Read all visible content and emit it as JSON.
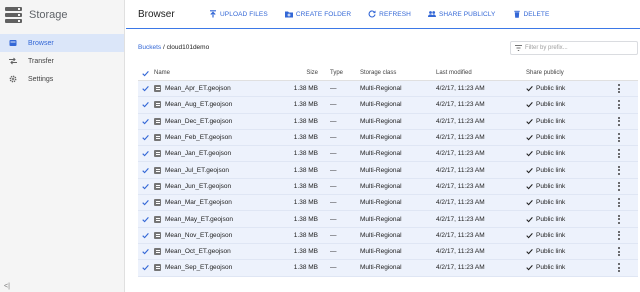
{
  "app": {
    "title": "Storage"
  },
  "sidebar": {
    "items": [
      {
        "label": "Browser",
        "icon": "bucket-icon",
        "active": true
      },
      {
        "label": "Transfer",
        "icon": "transfer-arrows-icon",
        "active": false
      },
      {
        "label": "Settings",
        "icon": "gear-icon",
        "active": false
      }
    ]
  },
  "toolbar": {
    "title": "Browser",
    "upload_label": "UPLOAD FILES",
    "create_folder_label": "CREATE FOLDER",
    "refresh_label": "REFRESH",
    "share_label": "SHARE PUBLICLY",
    "delete_label": "DELETE"
  },
  "breadcrumb": {
    "root": "Buckets",
    "separator": "/",
    "bucket": "cloud101demo"
  },
  "filter": {
    "placeholder": "Filter by prefix..."
  },
  "table": {
    "headers": {
      "name": "Name",
      "size": "Size",
      "type": "Type",
      "storage_class": "Storage class",
      "last_modified": "Last modified",
      "share": "Share publicly"
    },
    "rows": [
      {
        "name": "Mean_Apr_ET.geojson",
        "size": "1.38 MB",
        "type": "—",
        "storage_class": "Multi-Regional",
        "last_modified": "4/2/17, 11:23 AM",
        "share": "Public link"
      },
      {
        "name": "Mean_Aug_ET.geojson",
        "size": "1.38 MB",
        "type": "—",
        "storage_class": "Multi-Regional",
        "last_modified": "4/2/17, 11:23 AM",
        "share": "Public link"
      },
      {
        "name": "Mean_Dec_ET.geojson",
        "size": "1.38 MB",
        "type": "—",
        "storage_class": "Multi-Regional",
        "last_modified": "4/2/17, 11:23 AM",
        "share": "Public link"
      },
      {
        "name": "Mean_Feb_ET.geojson",
        "size": "1.38 MB",
        "type": "—",
        "storage_class": "Multi-Regional",
        "last_modified": "4/2/17, 11:23 AM",
        "share": "Public link"
      },
      {
        "name": "Mean_Jan_ET.geojson",
        "size": "1.38 MB",
        "type": "—",
        "storage_class": "Multi-Regional",
        "last_modified": "4/2/17, 11:23 AM",
        "share": "Public link"
      },
      {
        "name": "Mean_Jul_ET.geojson",
        "size": "1.38 MB",
        "type": "—",
        "storage_class": "Multi-Regional",
        "last_modified": "4/2/17, 11:23 AM",
        "share": "Public link"
      },
      {
        "name": "Mean_Jun_ET.geojson",
        "size": "1.38 MB",
        "type": "—",
        "storage_class": "Multi-Regional",
        "last_modified": "4/2/17, 11:23 AM",
        "share": "Public link"
      },
      {
        "name": "Mean_Mar_ET.geojson",
        "size": "1.38 MB",
        "type": "—",
        "storage_class": "Multi-Regional",
        "last_modified": "4/2/17, 11:23 AM",
        "share": "Public link"
      },
      {
        "name": "Mean_May_ET.geojson",
        "size": "1.38 MB",
        "type": "—",
        "storage_class": "Multi-Regional",
        "last_modified": "4/2/17, 11:23 AM",
        "share": "Public link"
      },
      {
        "name": "Mean_Nov_ET.geojson",
        "size": "1.38 MB",
        "type": "—",
        "storage_class": "Multi-Regional",
        "last_modified": "4/2/17, 11:23 AM",
        "share": "Public link"
      },
      {
        "name": "Mean_Oct_ET.geojson",
        "size": "1.38 MB",
        "type": "—",
        "storage_class": "Multi-Regional",
        "last_modified": "4/2/17, 11:23 AM",
        "share": "Public link"
      },
      {
        "name": "Mean_Sep_ET.geojson",
        "size": "1.38 MB",
        "type": "—",
        "storage_class": "Multi-Regional",
        "last_modified": "4/2/17, 11:23 AM",
        "share": "Public link"
      }
    ]
  },
  "colors": {
    "accent": "#3367d6",
    "selected_row": "#edf2fc",
    "toolbar_underline": "#3b78e7"
  }
}
